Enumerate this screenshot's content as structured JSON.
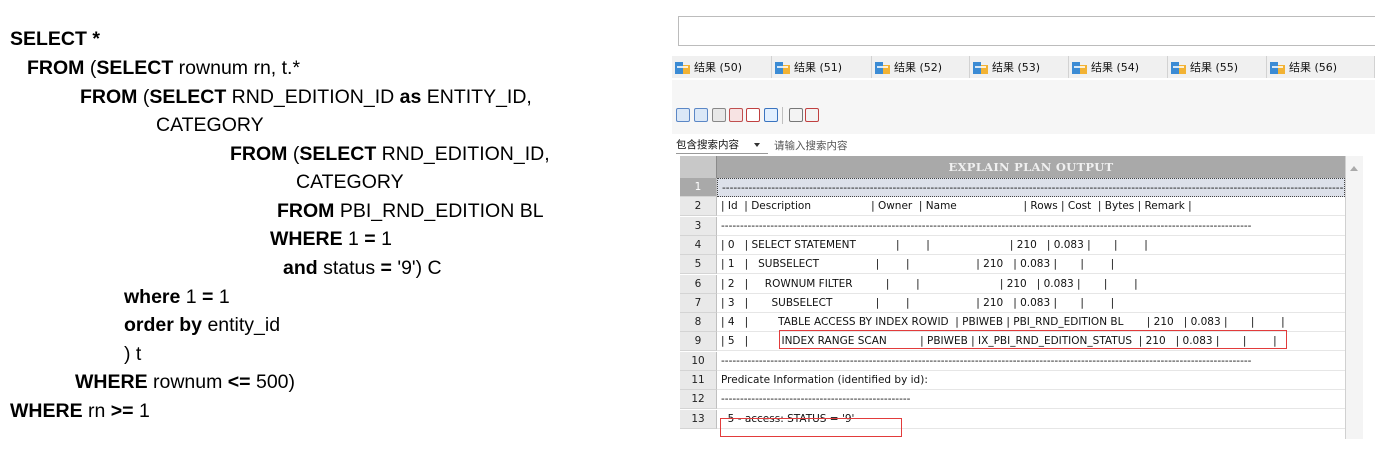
{
  "sql": {
    "lines": [
      {
        "parts": [
          {
            "t": "SELECT *",
            "b": true
          }
        ]
      },
      {
        "parts": [
          {
            "t": "FROM",
            "b": true
          },
          {
            "t": " (",
            "b": false
          },
          {
            "t": "SELECT",
            "b": true
          },
          {
            "t": " rownum rn, t.*",
            "b": false
          }
        ]
      },
      {
        "parts": [
          {
            "t": "FROM",
            "b": true
          },
          {
            "t": " (",
            "b": false
          },
          {
            "t": "SELECT",
            "b": true
          },
          {
            "t": " RND_EDITION_ID ",
            "b": false
          },
          {
            "t": "as",
            "b": true
          },
          {
            "t": " ENTITY_ID,",
            "b": false
          }
        ]
      },
      {
        "parts": [
          {
            "t": "CATEGORY",
            "b": false
          }
        ]
      },
      {
        "parts": [
          {
            "t": "FROM",
            "b": true
          },
          {
            "t": " (",
            "b": false
          },
          {
            "t": "SELECT",
            "b": true
          },
          {
            "t": " RND_EDITION_ID,",
            "b": false
          }
        ]
      },
      {
        "parts": [
          {
            "t": "CATEGORY",
            "b": false
          }
        ]
      },
      {
        "parts": [
          {
            "t": "FROM",
            "b": true
          },
          {
            "t": " PBI_RND_EDITION BL",
            "b": false
          }
        ]
      },
      {
        "parts": [
          {
            "t": "WHERE",
            "b": true
          },
          {
            "t": " 1 ",
            "b": false
          },
          {
            "t": "=",
            "b": true
          },
          {
            "t": " 1",
            "b": false
          }
        ]
      },
      {
        "parts": [
          {
            "t": "and",
            "b": true
          },
          {
            "t": " status ",
            "b": false
          },
          {
            "t": "=",
            "b": true
          },
          {
            "t": " '9') C",
            "b": false
          }
        ]
      },
      {
        "parts": [
          {
            "t": "where",
            "b": true
          },
          {
            "t": " 1 ",
            "b": false
          },
          {
            "t": "=",
            "b": true
          },
          {
            "t": " 1",
            "b": false
          }
        ]
      },
      {
        "parts": [
          {
            "t": "order by",
            "b": true
          },
          {
            "t": " entity_id",
            "b": false
          }
        ]
      },
      {
        "parts": [
          {
            "t": ") t",
            "b": false
          }
        ]
      },
      {
        "parts": [
          {
            "t": "WHERE",
            "b": true
          },
          {
            "t": " rownum ",
            "b": false
          },
          {
            "t": "<=",
            "b": true
          },
          {
            "t": " 500)",
            "b": false
          }
        ]
      },
      {
        "parts": [
          {
            "t": "WHERE",
            "b": true
          },
          {
            "t": " rn ",
            "b": false
          },
          {
            "t": ">=",
            "b": true
          },
          {
            "t": " 1",
            "b": false
          }
        ]
      }
    ]
  },
  "tabs": [
    "结果 (50)",
    "结果 (51)",
    "结果 (52)",
    "结果 (53)",
    "结果 (54)",
    "结果 (55)",
    "结果 (56)"
  ],
  "toolbar": {
    "icons": [
      "grid-view-icon",
      "form-view-icon",
      "export-icon",
      "edit-icon",
      "sql-icon",
      "search-icon",
      "prev-icon",
      "next-icon"
    ]
  },
  "filter": {
    "select_value": "包含搜索内容",
    "placeholder": "请输入搜索内容"
  },
  "grid": {
    "header": "EXPLAIN PLAN OUTPUT",
    "rows": [
      {
        "n": "1",
        "text": "--------------------------------------------------------------------------------------------------------------------------------------------------------------------------------------------------------------"
      },
      {
        "n": "2",
        "text": "| Id  | Description                  | Owner  | Name                    | Rows | Cost  | Bytes | Remark |"
      },
      {
        "n": "3",
        "text": "--------------------------------------------------------------------------------------------------------------------------------------------"
      },
      {
        "n": "4",
        "text": "| 0   | SELECT STATEMENT            |        |                        | 210   | 0.083 |       |        |"
      },
      {
        "n": "5",
        "text": "| 1   |   SUBSELECT                 |        |                    | 210   | 0.083 |       |        |"
      },
      {
        "n": "6",
        "text": "| 2   |     ROWNUM FILTER          |        |                        | 210   | 0.083 |       |        |"
      },
      {
        "n": "7",
        "text": "| 3   |       SUBSELECT             |        |                    | 210   | 0.083 |       |        |"
      },
      {
        "n": "8",
        "text": "| 4   |         TABLE ACCESS BY INDEX ROWID  | PBIWEB | PBI_RND_EDITION BL       | 210   | 0.083 |       |        |"
      },
      {
        "n": "9",
        "text": "| 5   |          INDEX RANGE SCAN          | PBIWEB | IX_PBI_RND_EDITION_STATUS  | 210   | 0.083 |       |        |"
      },
      {
        "n": "10",
        "text": "--------------------------------------------------------------------------------------------------------------------------------------------"
      },
      {
        "n": "11",
        "text": "Predicate Information (identified by id):"
      },
      {
        "n": "12",
        "text": "--------------------------------------------------"
      },
      {
        "n": "13",
        "text": "  5 - access: STATUS = '9'"
      }
    ]
  },
  "colors": {
    "highlight": "#e23b3b",
    "header_bg": "#a9a9a9",
    "selected_row_bg": "#dde1ea"
  }
}
